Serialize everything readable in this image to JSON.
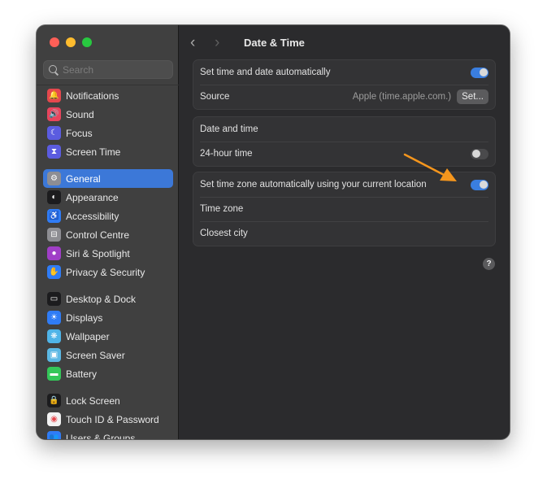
{
  "window": {
    "traffic_lights": [
      "close",
      "minimize",
      "maximize"
    ]
  },
  "sidebar": {
    "search": {
      "placeholder": "Search",
      "value": ""
    },
    "groups": [
      {
        "items": [
          {
            "label": "Notifications",
            "icon": "bell-icon",
            "glyph": "🔔",
            "color": "#e5484d"
          },
          {
            "label": "Sound",
            "icon": "speaker-icon",
            "glyph": "🔊",
            "color": "#e8455d"
          },
          {
            "label": "Focus",
            "icon": "moon-icon",
            "glyph": "☾",
            "color": "#5b5ce0"
          },
          {
            "label": "Screen Time",
            "icon": "hourglass-icon",
            "glyph": "⧗",
            "color": "#5b5ce0"
          }
        ]
      },
      {
        "items": [
          {
            "label": "General",
            "icon": "gear-icon",
            "glyph": "⚙",
            "color": "#8e8e93",
            "active": true
          },
          {
            "label": "Appearance",
            "icon": "appearance-icon",
            "glyph": "◐",
            "color": "#1c1c1e"
          },
          {
            "label": "Accessibility",
            "icon": "accessibility-icon",
            "glyph": "♿",
            "color": "#2f7cf6"
          },
          {
            "label": "Control Centre",
            "icon": "control-centre-icon",
            "glyph": "⊟",
            "color": "#8e8e93"
          },
          {
            "label": "Siri & Spotlight",
            "icon": "siri-icon",
            "glyph": "●",
            "color": "#a03ec7"
          },
          {
            "label": "Privacy & Security",
            "icon": "hand-icon",
            "glyph": "✋",
            "color": "#2f7cf6"
          }
        ]
      },
      {
        "items": [
          {
            "label": "Desktop & Dock",
            "icon": "dock-icon",
            "glyph": "▭",
            "color": "#1c1c1e"
          },
          {
            "label": "Displays",
            "icon": "sun-icon",
            "glyph": "☀",
            "color": "#2f7cf6"
          },
          {
            "label": "Wallpaper",
            "icon": "flower-icon",
            "glyph": "❋",
            "color": "#4fb4e8"
          },
          {
            "label": "Screen Saver",
            "icon": "screen-saver-icon",
            "glyph": "▣",
            "color": "#5cb8e4"
          },
          {
            "label": "Battery",
            "icon": "battery-icon",
            "glyph": "▬",
            "color": "#34c759"
          }
        ]
      },
      {
        "items": [
          {
            "label": "Lock Screen",
            "icon": "lock-icon",
            "glyph": "🔒",
            "color": "#1c1c1e"
          },
          {
            "label": "Touch ID & Password",
            "icon": "fingerprint-icon",
            "glyph": "◉",
            "color": "#f2f2f2",
            "glyph_color": "#e5484d"
          },
          {
            "label": "Users & Groups",
            "icon": "users-icon",
            "glyph": "👥",
            "color": "#2f7cf6"
          }
        ]
      }
    ]
  },
  "main": {
    "back_label": "‹",
    "forward_label": "›",
    "title": "Date & Time",
    "groups": [
      {
        "rows": [
          {
            "label": "Set time and date automatically",
            "toggle": true
          },
          {
            "label": "Source",
            "value": "Apple (time.apple.com.)",
            "button": "Set..."
          }
        ]
      },
      {
        "rows": [
          {
            "label": "Date and time"
          },
          {
            "label": "24-hour time",
            "toggle": false
          }
        ]
      },
      {
        "rows": [
          {
            "label": "Set time zone automatically using your current location",
            "toggle": true
          },
          {
            "label": "Time zone"
          },
          {
            "label": "Closest city"
          }
        ]
      }
    ],
    "help_label": "?"
  },
  "annotation": {
    "type": "arrow",
    "color": "#f5961d",
    "points_to": "Set time zone automatically toggle"
  }
}
